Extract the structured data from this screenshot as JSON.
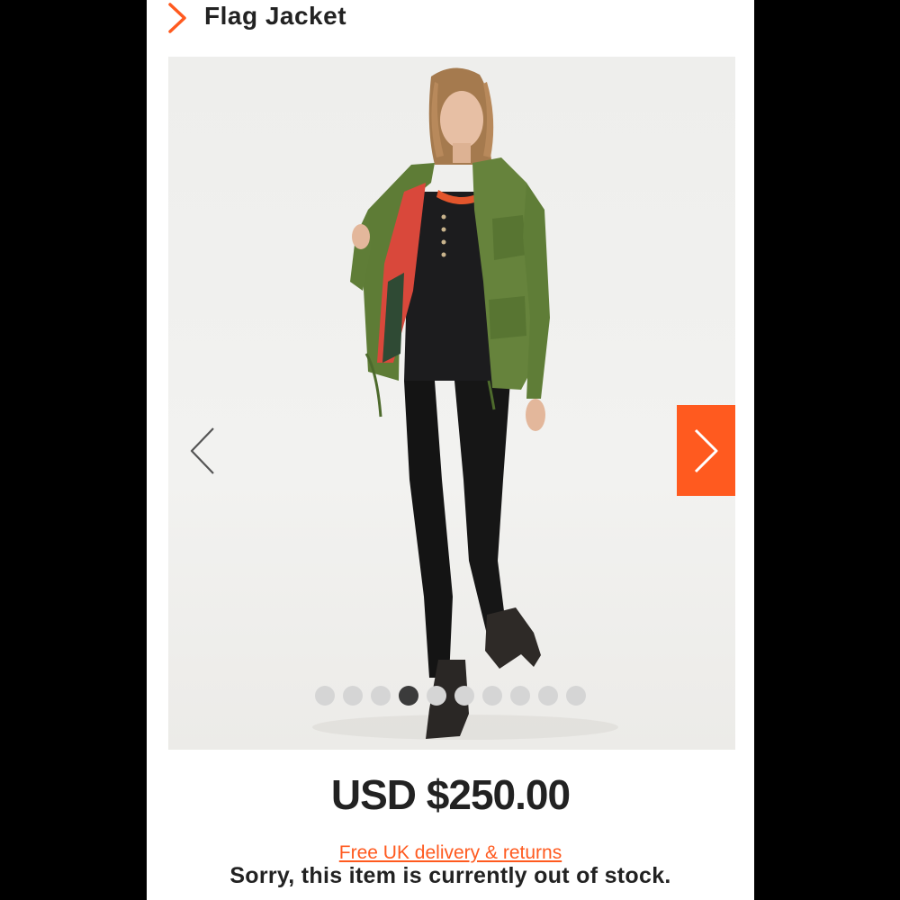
{
  "header": {
    "title": "Flag Jacket",
    "icon": "chevron-right-icon",
    "accent_color": "#ff5a1f"
  },
  "gallery": {
    "image_description": "product-photo",
    "prev_icon": "chevron-left-icon",
    "next_icon": "chevron-right-icon",
    "slide_count": 10,
    "active_slide": 4
  },
  "product": {
    "price": "USD $250.00",
    "delivery_link": "Free UK delivery & returns",
    "stock_message": "Sorry, this item is currently out of stock."
  }
}
